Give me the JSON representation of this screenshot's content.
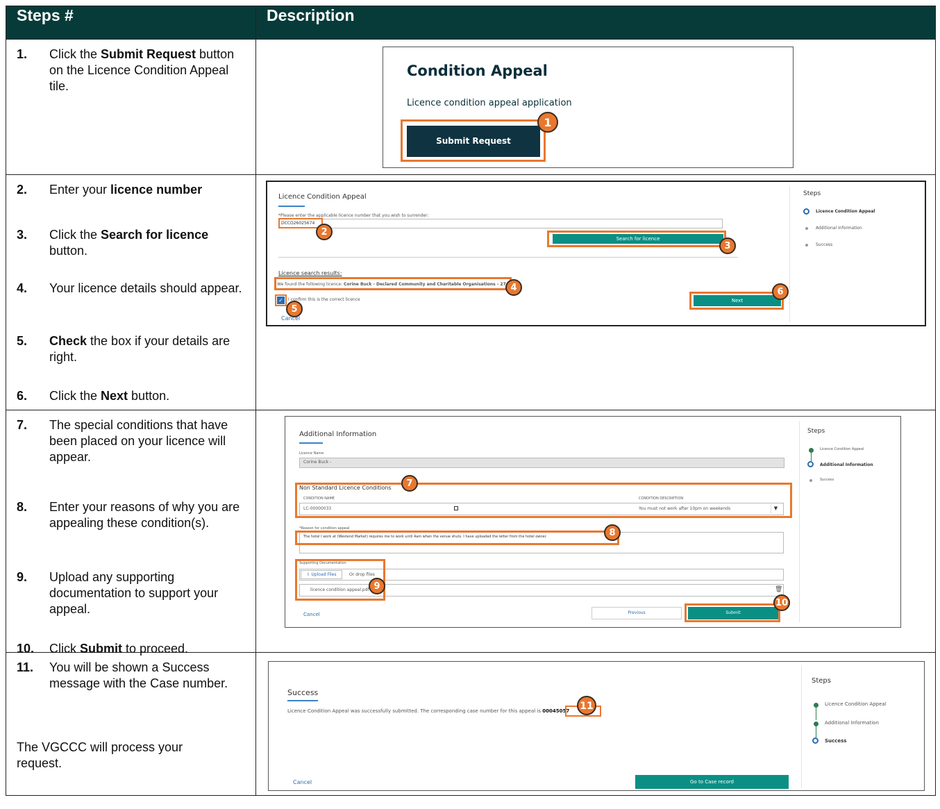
{
  "header": {
    "steps_col": "Steps #",
    "desc_col": "Description"
  },
  "steps": [
    {
      "num": "1.",
      "pre": "Click the ",
      "bold": "Submit Request",
      "post": " button on the Licence Condition Appeal tile."
    },
    {
      "num": "2.",
      "pre": "Enter your ",
      "bold": "licence number",
      "post": ""
    },
    {
      "num": "3.",
      "pre": "Click the ",
      "bold": "Search for licence",
      "post": " button."
    },
    {
      "num": "4.",
      "pre": "Your licence details should appear.",
      "bold": "",
      "post": ""
    },
    {
      "num": "5.",
      "pre": "",
      "bold": "Check",
      "post": " the box if your details are right."
    },
    {
      "num": "6.",
      "pre": "Click the ",
      "bold": "Next",
      "post": " button."
    },
    {
      "num": "7.",
      "pre": "The special conditions that have been placed on your licence will appear.",
      "bold": "",
      "post": ""
    },
    {
      "num": "8.",
      "pre": "Enter your reasons of why you are appealing these condition(s).",
      "bold": "",
      "post": ""
    },
    {
      "num": "9.",
      "pre": "Upload any supporting documentation to support your appeal.",
      "bold": "",
      "post": ""
    },
    {
      "num": "10.",
      "pre": "Click ",
      "bold": "Submit",
      "post": " to proceed."
    },
    {
      "num": "11.",
      "pre": "You will be shown a Success message with the Case number.",
      "bold": "",
      "post": ""
    }
  ],
  "step11_note": "The VGCCC will process your request.",
  "shot1": {
    "title": "Condition Appeal",
    "subtitle": "Licence condition appeal application",
    "button": "Submit Request",
    "badge": "1"
  },
  "shot2": {
    "title": "Licence Condition Appeal",
    "prompt": "*Please enter the applicable licence number that you wish to surrender:",
    "licence_value": "DCCO26025674",
    "search_button": "Search for licence",
    "results_label": "Licence search results:",
    "result_prefix": "We found the following licence: ",
    "result_bold": "Corine Buck - Declared Community and Charitable Organisations - 27/1/26",
    "confirm_label": "I confirm this is the correct licence",
    "cancel": "Cancel",
    "next": "Next",
    "steps_title": "Steps",
    "steps": [
      "Licence Condition Appeal",
      "Additional Information",
      "Success"
    ],
    "badges": [
      "2",
      "3",
      "4",
      "5",
      "6"
    ]
  },
  "shot3": {
    "title": "Additional Information",
    "licence_name_label": "Licence Name",
    "licence_name_value": "Corine Buck -",
    "conditions_label": "Non Standard Licence Conditions",
    "col_name": "CONDITION NAME",
    "col_desc": "CONDITION DESCRIPTION",
    "cond_name": "LC-00000033",
    "cond_desc": "You must not work after 10pm on weekends",
    "reason_label": "*Reason for condition appeal",
    "reason_text": "The hotel I work at (Westend Market) requires me to work until 4am when the venue shuts. I have uploaded the letter from the hotel owner.",
    "docs_label": "Supporting Documentation",
    "upload": "Upload Files",
    "drop": "Or drop files",
    "file": "licence condition appeal.pdf",
    "cancel": "Cancel",
    "previous": "Previous",
    "submit": "Submit",
    "steps_title": "Steps",
    "steps": [
      "Licence Condition Appeal",
      "Additional Information",
      "Success"
    ],
    "badges": [
      "7",
      "8",
      "9",
      "10"
    ]
  },
  "shot4": {
    "title": "Success",
    "message": "Licence Condition Appeal was successfully submitted. The corresponding case number for this appeal is ",
    "case_number": "00045057",
    "cancel": "Cancel",
    "go_button": "Go to Case record",
    "steps_title": "Steps",
    "steps": [
      "Licence Condition Appeal",
      "Additional Information",
      "Success"
    ],
    "badge": "11"
  },
  "colors": {
    "header_bg": "#073b3a",
    "accent_orange": "#e8782f",
    "teal": "#0b8f84"
  }
}
